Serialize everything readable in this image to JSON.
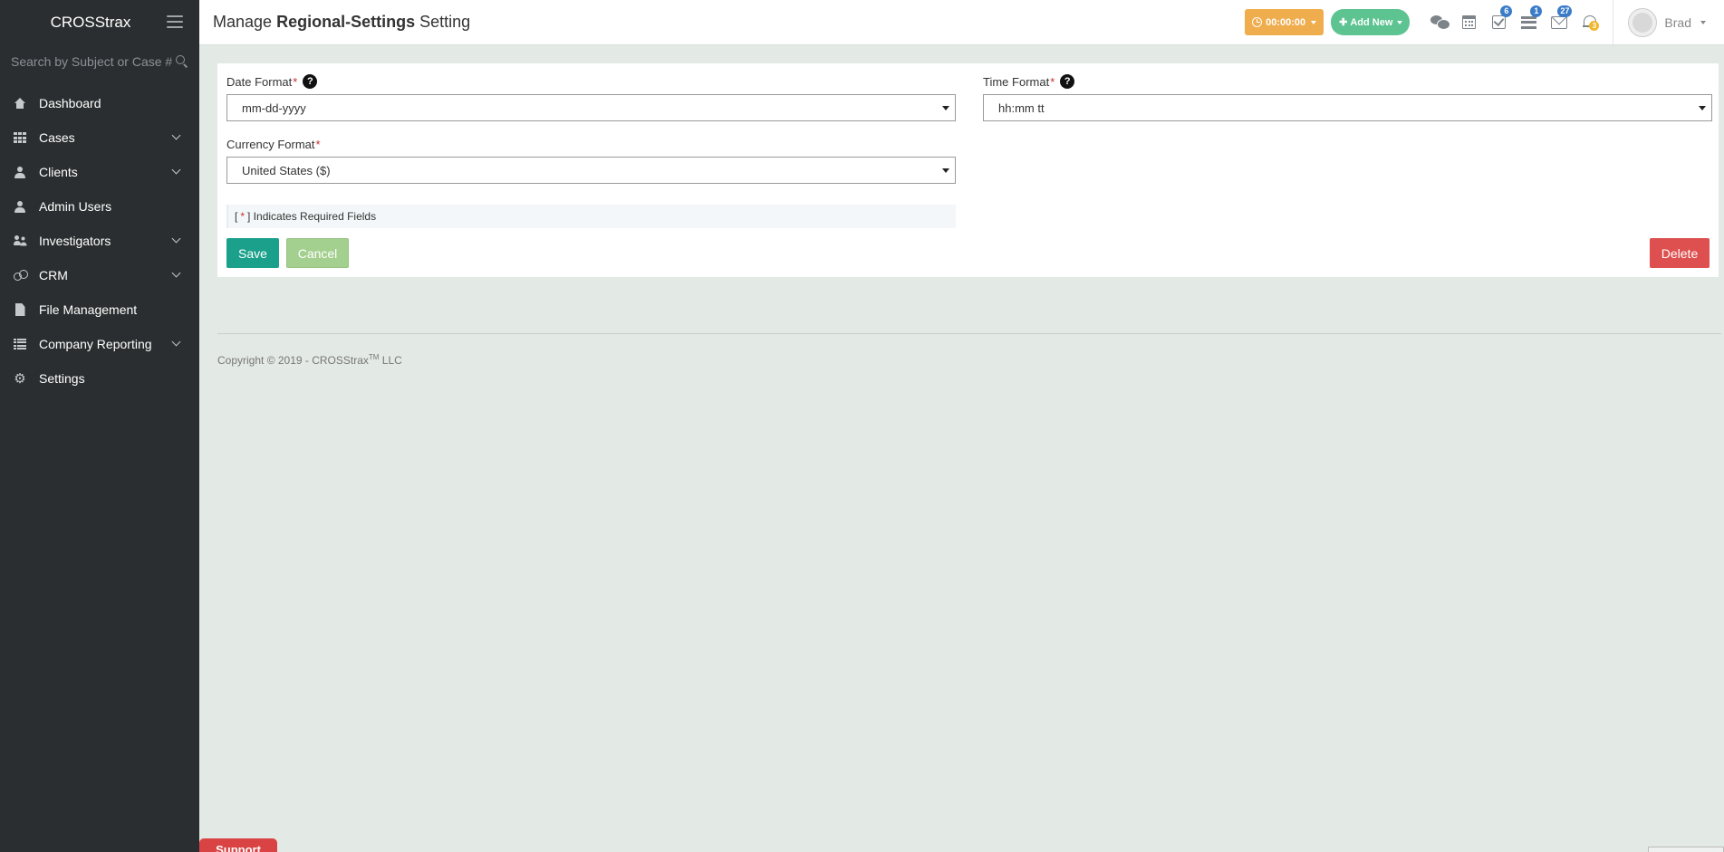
{
  "sidebar": {
    "brand": "CROSStrax",
    "search_placeholder": "Search by Subject or Case #",
    "items": [
      {
        "label": "Dashboard",
        "icon": "home-icon",
        "has_submenu": false
      },
      {
        "label": "Cases",
        "icon": "grid-icon",
        "has_submenu": true
      },
      {
        "label": "Clients",
        "icon": "user-icon",
        "has_submenu": true
      },
      {
        "label": "Admin Users",
        "icon": "user-icon",
        "has_submenu": false
      },
      {
        "label": "Investigators",
        "icon": "users-icon",
        "has_submenu": true
      },
      {
        "label": "CRM",
        "icon": "crm-icon",
        "has_submenu": true
      },
      {
        "label": "File Management",
        "icon": "file-icon",
        "has_submenu": false
      },
      {
        "label": "Company Reporting",
        "icon": "list-icon",
        "has_submenu": true
      },
      {
        "label": "Settings",
        "icon": "gear-icon",
        "has_submenu": false
      }
    ]
  },
  "header": {
    "title_prefix": "Manage",
    "title_bold": "Regional-Settings",
    "title_suffix": "Setting",
    "timer_label": "00:00:00",
    "add_new_label": "Add New",
    "badges": {
      "tasks": "6",
      "todo": "1",
      "mail": "27",
      "notifications": "3"
    },
    "user_name": "Brad"
  },
  "form": {
    "date_format": {
      "label": "Date Format",
      "required_mark": "*",
      "help": "?",
      "value": "mm-dd-yyyy"
    },
    "time_format": {
      "label": "Time Format",
      "required_mark": "*",
      "help": "?",
      "value": "hh:mm tt"
    },
    "currency_format": {
      "label": "Currency Format",
      "required_mark": "*",
      "value": "United States ($)"
    },
    "required_note": {
      "open": "[",
      "star": "*",
      "text": "] Indicates Required Fields"
    },
    "save_label": "Save",
    "cancel_label": "Cancel",
    "delete_label": "Delete"
  },
  "footer": {
    "copyright_pre": "Copyright © 2019 - CROSStrax",
    "tm": "TM",
    "copyright_post": " LLC",
    "support_label": "Support"
  },
  "colors": {
    "sidebar_bg": "#2b2e30",
    "page_bg": "#e3e9e5",
    "timer": "#f0ad4e",
    "add_new": "#5cc391",
    "save": "#1aa08b",
    "cancel": "#a3cf8f",
    "delete": "#de4f4f",
    "badge": "#3b7cc9"
  }
}
